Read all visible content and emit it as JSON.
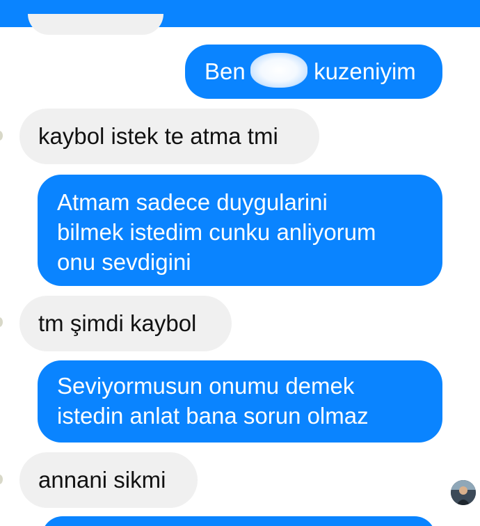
{
  "header": {
    "color": "#0a84ff"
  },
  "messages": [
    {
      "from": "me",
      "text": "Ben •••• kuzeniyim"
    },
    {
      "from": "them",
      "text": "kaybol istek te atma tmi"
    },
    {
      "from": "me",
      "lines": [
        "Atmam sadece duygularini",
        "bilmek istedim cunku anliyorum",
        "onu sevdigini"
      ]
    },
    {
      "from": "them",
      "text": "tm şimdi kaybol"
    },
    {
      "from": "me",
      "lines": [
        "Seviyormusun onumu demek",
        "istedin anlat bana sorun olmaz"
      ]
    },
    {
      "from": "them",
      "text": "annani sikmi"
    }
  ],
  "msg1": {
    "before": "Ben",
    "after": "kuzeniyim"
  },
  "colors": {
    "outgoing": "#0a84ff",
    "incoming": "#f0f0f0",
    "background": "#ffffff"
  },
  "icons": {
    "avatar": "user-avatar-icon"
  }
}
